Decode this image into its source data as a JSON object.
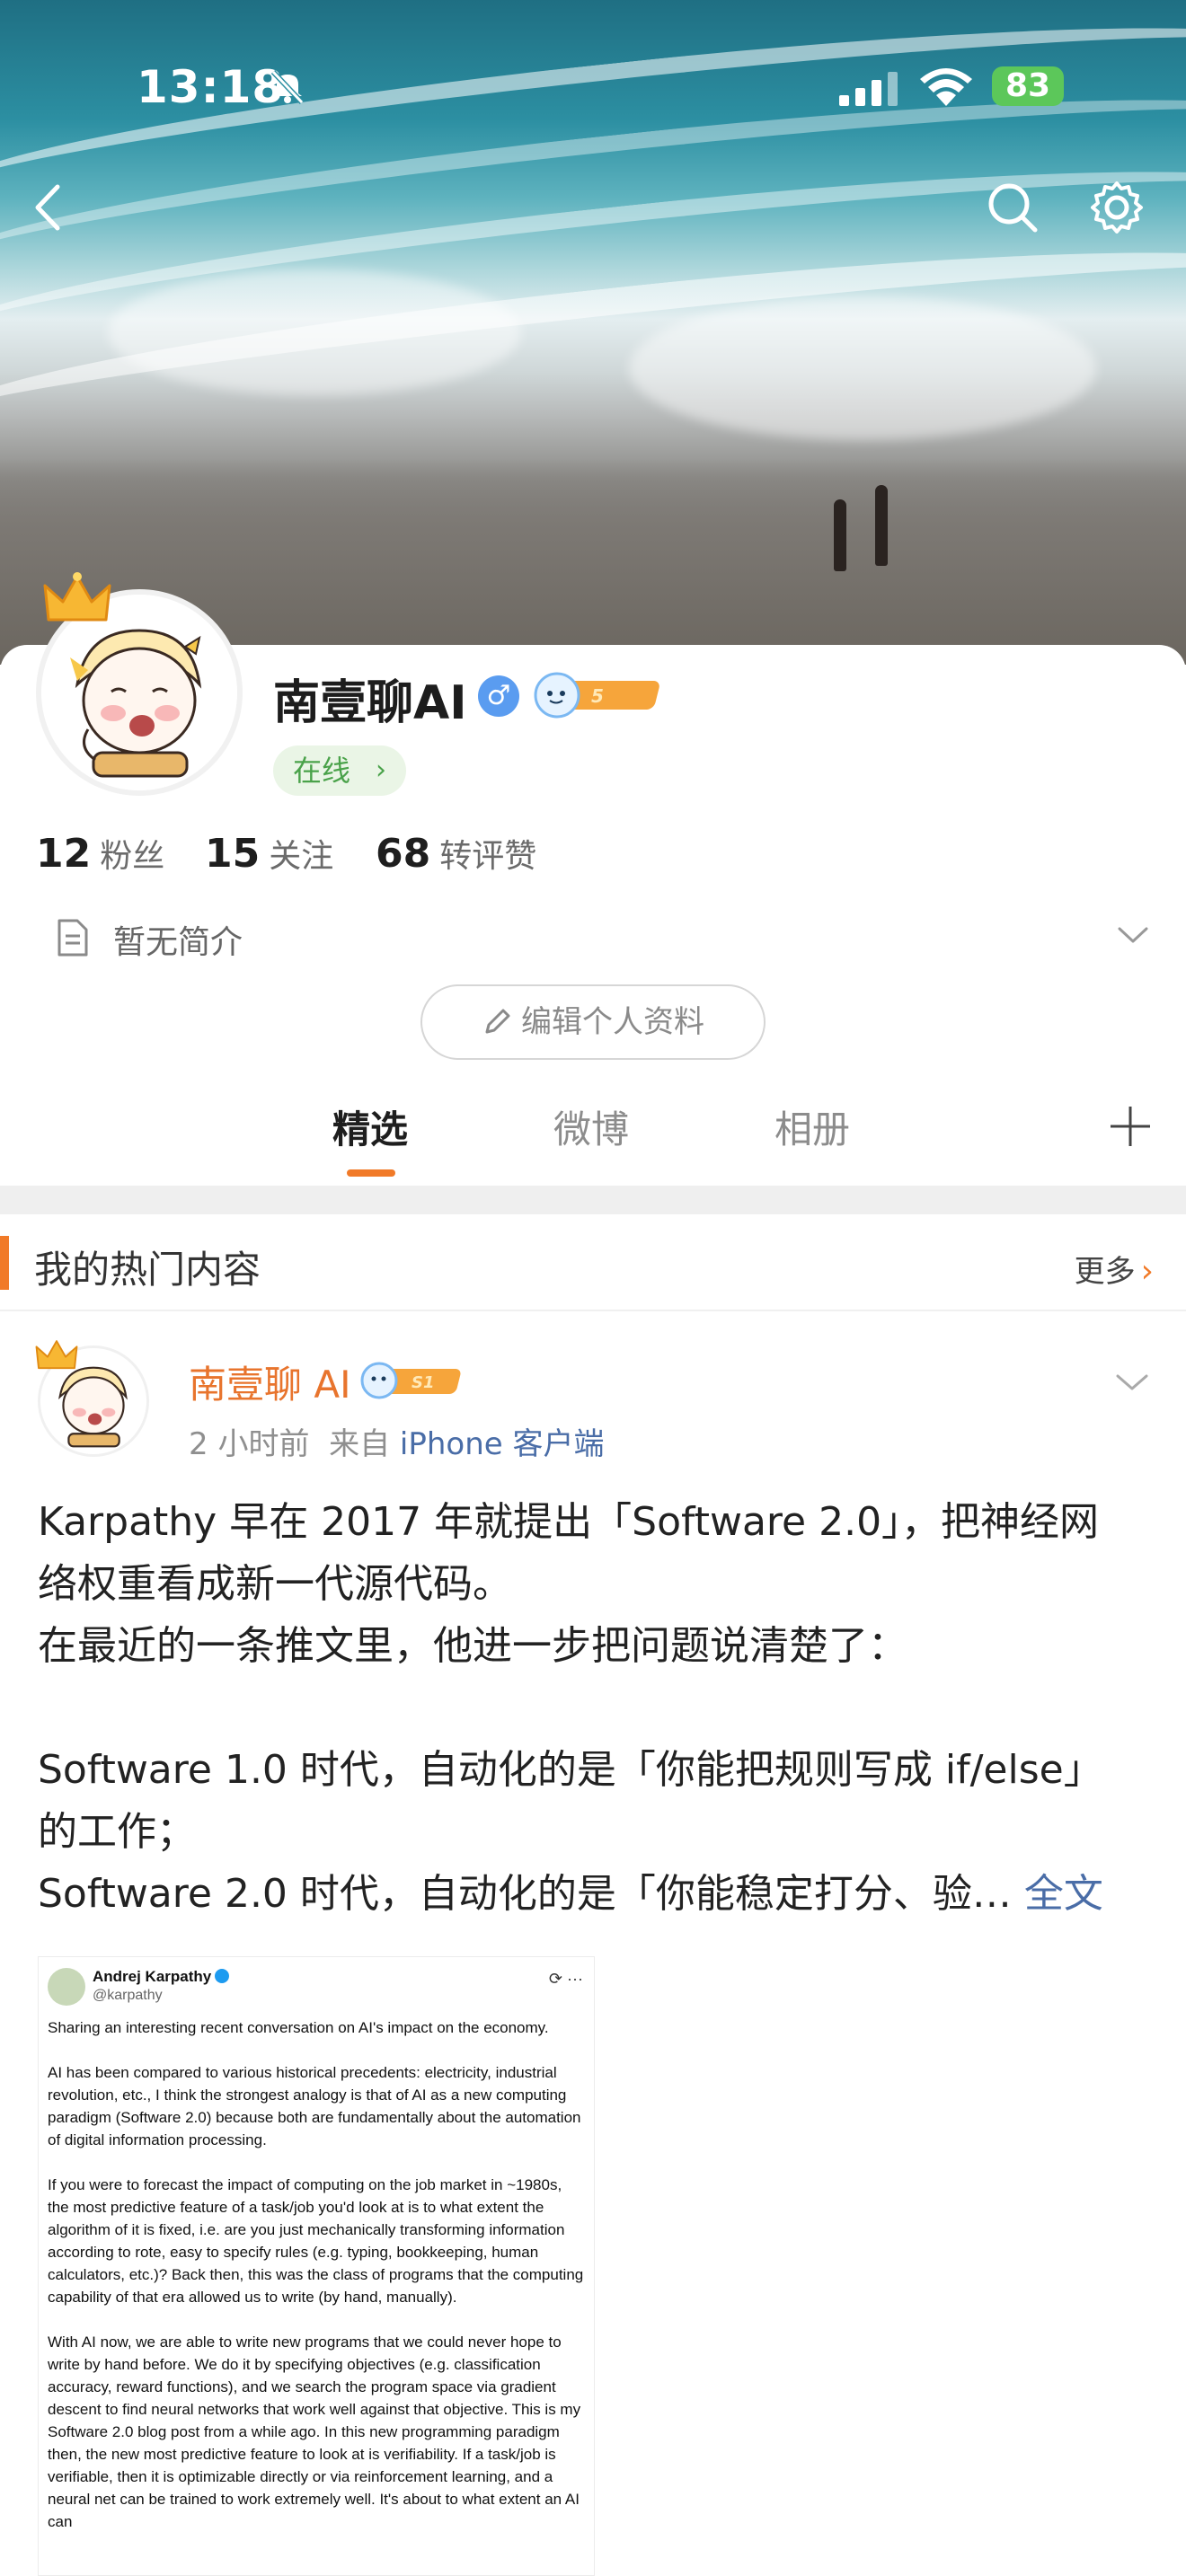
{
  "status_bar": {
    "time": "13:18",
    "battery": "83"
  },
  "profile": {
    "name": "南壹聊AI",
    "gender_symbol": "♂",
    "online": "在线",
    "stats": [
      {
        "value": "12",
        "label": "粉丝"
      },
      {
        "value": "15",
        "label": "关注"
      },
      {
        "value": "68",
        "label": "转评赞"
      }
    ],
    "bio": "暂无简介",
    "edit_button": "编辑个人资料"
  },
  "tabs": [
    {
      "label": "精选",
      "active": true
    },
    {
      "label": "微博",
      "active": false
    },
    {
      "label": "相册",
      "active": false
    }
  ],
  "hot_section": {
    "title": "我的热门内容",
    "more": "更多"
  },
  "post": {
    "author": "南壹聊 AI",
    "time": "2 小时前",
    "from_prefix": "来自",
    "source": "iPhone 客户端",
    "lines": [
      "Karpathy 早在 2017 年就提出「Software 2.0」，把神经网",
      "络权重看成新一代源代码。",
      "在最近的一条推文里，他进一步把问题说清楚了：",
      "",
      "Software 1.0 时代，自动化的是「你能把规则写成 if/else」",
      "的工作；",
      "Software 2.0 时代，自动化的是「你能稳定打分、验…"
    ],
    "full_text_link": "全文"
  },
  "tweet": {
    "name": "Andrej Karpathy",
    "handle": "@karpathy",
    "paragraphs": [
      "Sharing an interesting recent conversation on AI's impact on the economy.",
      "AI has been compared to various historical precedents: electricity, industrial revolution, etc., I think the strongest analogy is that of AI as a new computing paradigm (Software 2.0) because both are fundamentally about the automation of digital information processing.",
      "If you were to forecast the impact of computing on the job market in ~1980s, the most predictive feature of a task/job you'd look at is to what extent the algorithm of it is fixed, i.e. are you just mechanically transforming information according to rote, easy to specify rules (e.g. typing, bookkeeping, human calculators, etc.)? Back then, this was the class of programs that the computing capability of that era allowed us to write (by hand, manually).",
      "With AI now, we are able to write new programs that we could never hope to write by hand before. We do it by specifying objectives (e.g. classification accuracy, reward functions), and we search the program space via gradient descent to find neural networks that work well against that objective. This is my Software 2.0 blog post from a while ago. In this new programming paradigm then, the new most predictive feature to look at is verifiability. If a task/job is verifiable, then it is optimizable directly or via reinforcement learning, and a neural net can be trained to work extremely well. It's about to what extent an AI can"
    ]
  }
}
